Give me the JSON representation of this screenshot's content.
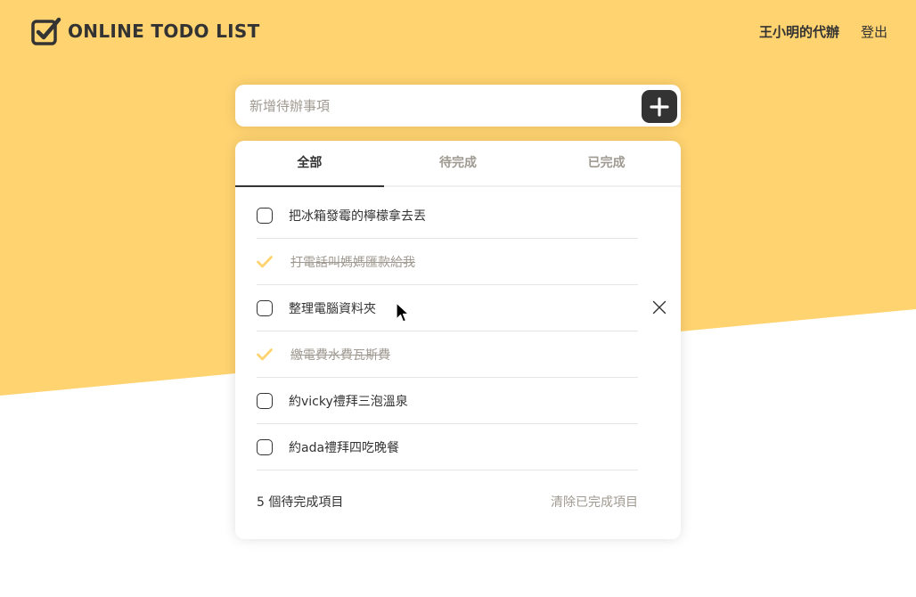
{
  "colors": {
    "accent": "#FFD370",
    "text": "#333333",
    "muted": "#9F9A91",
    "white": "#FFFFFF"
  },
  "header": {
    "logo_text": "ONLINE TODO LIST",
    "user_label": "王小明的代辦",
    "logout_label": "登出"
  },
  "add_todo": {
    "placeholder": "新增待辦事項",
    "value": "",
    "button_icon": "plus-icon"
  },
  "tabs": [
    {
      "label": "全部",
      "active": true
    },
    {
      "label": "待完成",
      "active": false
    },
    {
      "label": "已完成",
      "active": false
    }
  ],
  "todos": [
    {
      "text": "把冰箱發霉的檸檬拿去丟",
      "done": false
    },
    {
      "text": "打電話叫媽媽匯款給我",
      "done": true
    },
    {
      "text": "整理電腦資料夾",
      "done": false,
      "hovered": true
    },
    {
      "text": "繳電費水費瓦斯費",
      "done": true
    },
    {
      "text": "約vicky禮拜三泡溫泉",
      "done": false
    },
    {
      "text": "約ada禮拜四吃晚餐",
      "done": false
    }
  ],
  "footer": {
    "count_label": "5 個待完成項目",
    "clear_label": "清除已完成項目"
  }
}
